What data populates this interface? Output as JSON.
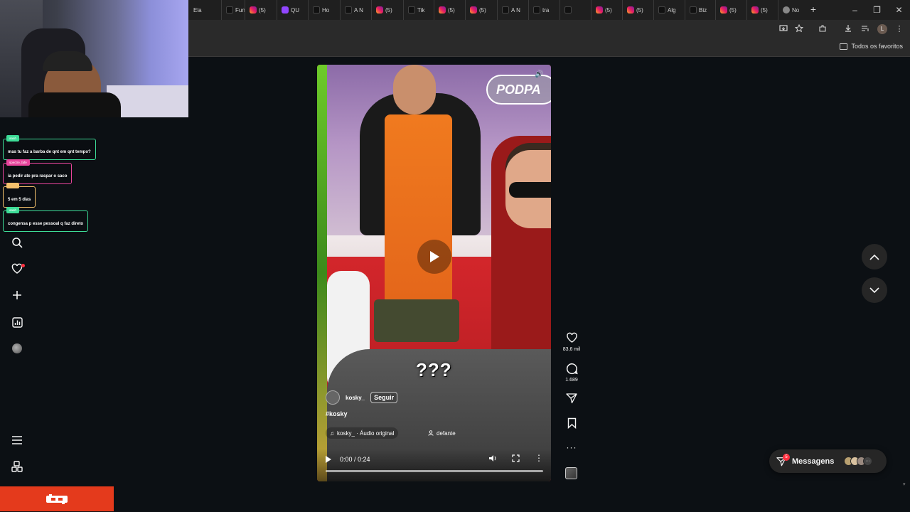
{
  "browser": {
    "tabs": [
      {
        "icon": "generic",
        "label": "Ela"
      },
      {
        "icon": "tiktok",
        "label": "Fun"
      },
      {
        "icon": "instagram",
        "label": "(5)"
      },
      {
        "icon": "twitch",
        "label": "QU"
      },
      {
        "icon": "tiktok",
        "label": "Ho"
      },
      {
        "icon": "tiktok",
        "label": "A N"
      },
      {
        "icon": "instagram",
        "label": "(5)"
      },
      {
        "icon": "tiktok",
        "label": "Tik"
      },
      {
        "icon": "instagram",
        "label": "(5)"
      },
      {
        "icon": "instagram",
        "label": "(5)"
      },
      {
        "icon": "tiktok",
        "label": "A N"
      },
      {
        "icon": "tiktok",
        "label": "tra"
      },
      {
        "icon": "tiktok",
        "label": ""
      },
      {
        "icon": "instagram",
        "label": "(5)"
      },
      {
        "icon": "instagram",
        "label": "(5)"
      },
      {
        "icon": "tiktok",
        "label": "Alg"
      },
      {
        "icon": "tiktok",
        "label": "Biz"
      },
      {
        "icon": "instagram",
        "label": "(5)"
      },
      {
        "icon": "instagram",
        "label": "(5)"
      },
      {
        "icon": "globe",
        "label": "No"
      }
    ],
    "new_tab": "+",
    "window": {
      "minimize": "–",
      "restore": "❐",
      "close": "✕"
    },
    "toolbar": {
      "profile_initial": "L"
    },
    "bookmarks": {
      "all_favorites": "Todos os favoritos"
    }
  },
  "chat": [
    {
      "user": "aaah",
      "user_color": "#3ddc97",
      "message": "mas tu faz a barba de qnt em qnt tempo?"
    },
    {
      "user": "spectre_fafe",
      "user_color": "#e8459c",
      "message": "ia pedir ate pra raspar o saco"
    },
    {
      "user": "",
      "user_color": "#f5c16c",
      "message": "5 em 5 dias"
    },
    {
      "user": "aaah",
      "user_color": "#3ddc97",
      "message": "congensa p esse pessoal q faz direto"
    }
  ],
  "reel": {
    "caption_overlay": "???",
    "watermark": "PODPA",
    "username": "kosky_",
    "follow_label": "Seguir",
    "hashtag": "#kosky",
    "audio": "kosky_ · Áudio original",
    "coauthor": "defante",
    "time": "0:00 / 0:24",
    "progress": 0.0
  },
  "actions": {
    "likes": "83,6 mil",
    "comments": "1.689"
  },
  "messages": {
    "label": "Messagens",
    "badge": "5"
  },
  "colors": {
    "background": "#0c1014",
    "accent_red": "#ff3040",
    "stream_logo": "#e43a1c",
    "chat_border": "#3ddc97"
  }
}
